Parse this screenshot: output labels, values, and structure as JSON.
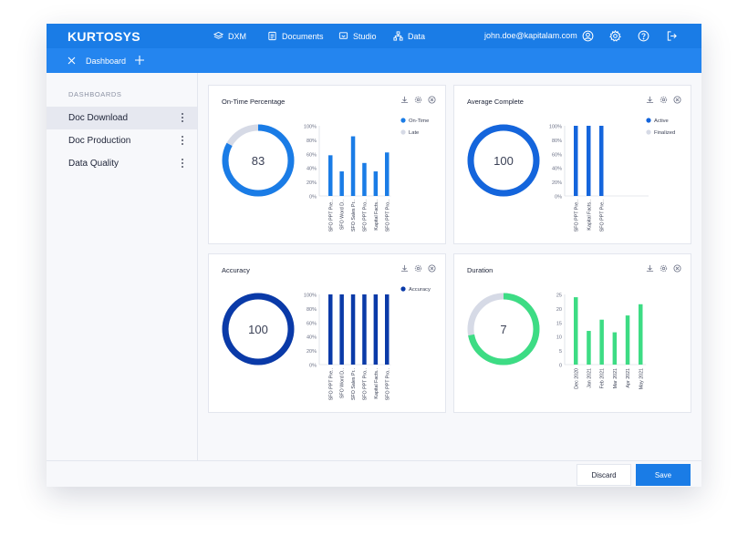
{
  "app": {
    "logo": "KURTOSYS",
    "user_email": "john.doe@kapitalam.com"
  },
  "nav": [
    {
      "label": "DXM",
      "icon": "layers-icon"
    },
    {
      "label": "Documents",
      "icon": "document-icon"
    },
    {
      "label": "Studio",
      "icon": "studio-icon"
    },
    {
      "label": "Data",
      "icon": "hierarchy-icon"
    }
  ],
  "tab": {
    "label": "Dashboard"
  },
  "sidebar": {
    "heading": "DASHBOARDS",
    "items": [
      {
        "label": "Doc Download",
        "active": true
      },
      {
        "label": "Doc Production",
        "active": false
      },
      {
        "label": "Data Quality",
        "active": false
      }
    ]
  },
  "footer": {
    "discard_label": "Discard",
    "save_label": "Save"
  },
  "colors": {
    "primary": "#1a7ce6",
    "dark_blue": "#0a3aa8",
    "mid_blue": "#1465dc",
    "green": "#3ddc84",
    "gray": "#d6dae6"
  },
  "chart_data": [
    {
      "id": "ontime",
      "type": "bar",
      "title": "On-Time Percentage",
      "gauge_value": 83,
      "gauge_percent": 83,
      "categories": [
        "SFO PPT Pre..",
        "SFO Word D..",
        "SFO Sales Pr..",
        "SFO PPT Pro..",
        "Kapital Facts..",
        "SFO PPT Pro.."
      ],
      "values": [
        58,
        35,
        85,
        47,
        35,
        62
      ],
      "yticks": [
        "100%",
        "80%",
        "60%",
        "40%",
        "20%",
        "0%"
      ],
      "ylim": [
        0,
        100
      ],
      "legend": [
        "On-Time",
        "Late"
      ],
      "legend_position": "top-right"
    },
    {
      "id": "average",
      "type": "bar",
      "title": "Average Complete",
      "gauge_value": 100,
      "gauge_percent": 100,
      "categories": [
        "SFO PPT Pre..",
        "Kapital Facts..",
        "SFO PPT Pre.."
      ],
      "values": [
        100,
        100,
        100
      ],
      "yticks": [
        "100%",
        "80%",
        "60%",
        "40%",
        "20%",
        "0%"
      ],
      "ylim": [
        0,
        100
      ],
      "legend": [
        "Active",
        "Finalized"
      ],
      "legend_position": "top-right"
    },
    {
      "id": "accuracy",
      "type": "bar",
      "title": "Accuracy",
      "gauge_value": 100,
      "gauge_percent": 100,
      "categories": [
        "SFO PPT Pre..",
        "SFO Word D..",
        "SFO Sales Pr..",
        "SFO PPT Pro..",
        "Kapital Facts..",
        "SFO PPT Pro.."
      ],
      "values": [
        100,
        100,
        100,
        100,
        100,
        100
      ],
      "yticks": [
        "100%",
        "80%",
        "60%",
        "40%",
        "20%",
        "0%"
      ],
      "ylim": [
        0,
        100
      ],
      "legend": [
        "Accuracy"
      ],
      "legend_position": "top-right"
    },
    {
      "id": "duration",
      "type": "bar",
      "title": "Duration",
      "gauge_value": 7,
      "gauge_percent": 72,
      "categories": [
        "Dec 2020",
        "Jan 2021",
        "Feb 2021",
        "Mar 2021",
        "Apr 2021",
        "May 2021"
      ],
      "values": [
        24,
        12,
        16,
        11.5,
        17.5,
        21.5
      ],
      "yticks": [
        "25",
        "20",
        "15",
        "10",
        "5",
        "0"
      ],
      "ylim": [
        0,
        25
      ],
      "legend": [],
      "legend_position": "none"
    }
  ]
}
